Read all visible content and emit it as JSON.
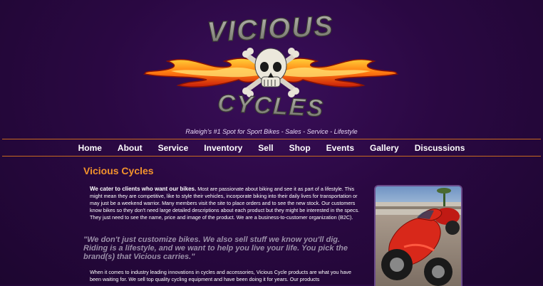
{
  "header": {
    "logo_top": "VICIOUS",
    "logo_bottom": "CYCLES",
    "tagline": "Raleigh's #1 Spot for Sport Bikes - Sales - Service - Lifestyle"
  },
  "nav": {
    "items": [
      "Home",
      "About",
      "Service",
      "Inventory",
      "Sell",
      "Shop",
      "Events",
      "Gallery",
      "Discussions"
    ]
  },
  "main": {
    "title": "Vicious Cycles",
    "intro_bold": "We cater to clients who want our bikes.",
    "intro_rest": " Most are passionate about biking and see it as part of a lifestyle. This might mean they are competitive, like to style their vehicles, incorporate biking into their daily lives for transportation or may just be a weekend warrior. Many members visit the site to place orders and to see the new stock. Our customers know bikes so they don't need large detailed descriptions about each product but they might be interested in the specs. They just need to see the name, price and image of the product. We are a business-to-customer organization (B2C).",
    "quote": "\"We don't just customize bikes. We also sell stuff we know you'll dig. Riding is a lifestyle, and we want to help you live your life. You pick the brand(s) that Vicious carries.\"",
    "para2": "When it comes to industry leading innovations in cycles and accessories, Vicious Cycle products are what you have been waiting for. We sell top quality cycling equipment and have been doing it for years. Our products"
  },
  "colors": {
    "background": "#2a0842",
    "accent": "#f3932c",
    "rule": "#c76a1f",
    "quote": "#9a8fa8"
  },
  "icons": {
    "logo": "skull-crossbones-flames-logo",
    "photo": "red-sport-motorcycle-photo"
  }
}
